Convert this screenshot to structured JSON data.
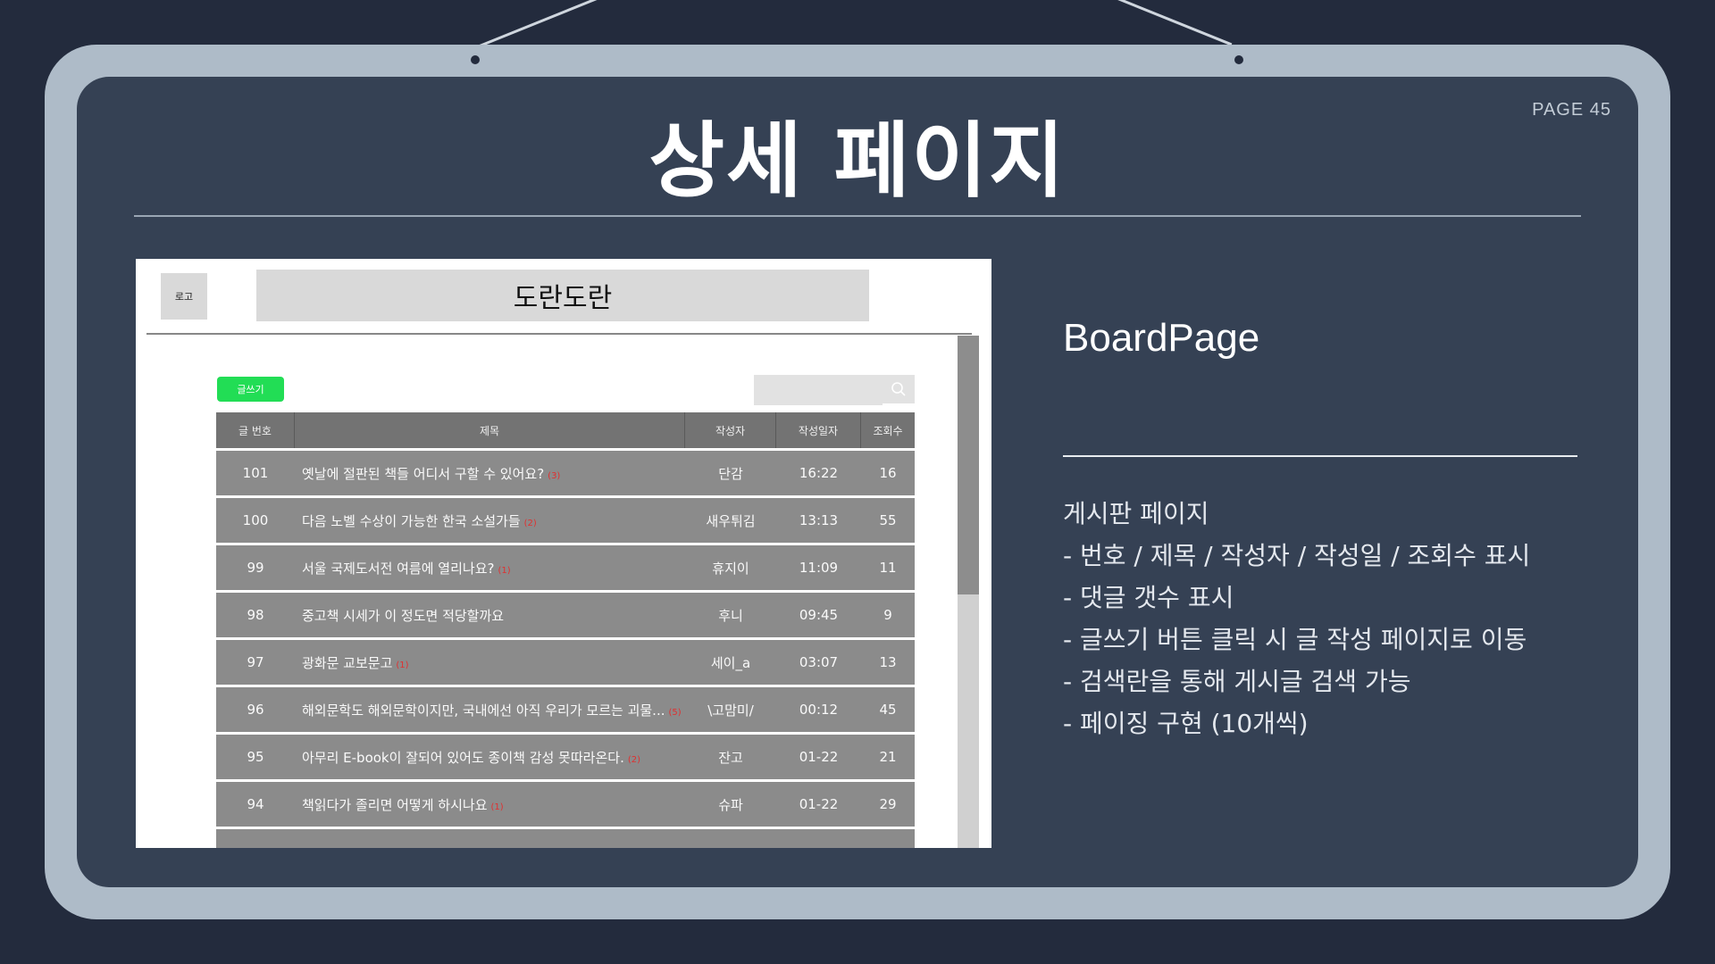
{
  "slide": {
    "page_label": "PAGE 45",
    "title": "상세 페이지",
    "subtitle": "BoardPage",
    "description": [
      "게시판 페이지",
      "- 번호 / 제목 / 작성자 / 작성일 / 조회수 표시",
      "- 댓글 갯수 표시",
      "- 글쓰기 버튼 클릭 시 글 작성 페이지로 이동",
      "- 검색란을 통해 게시글 검색 가능",
      "- 페이징 구현 (10개씩)"
    ]
  },
  "mock": {
    "logo_label": "로고",
    "site_title": "도란도란",
    "write_button": "글쓰기",
    "search": {
      "placeholder": "",
      "icon": "search-icon"
    },
    "columns": [
      "글 번호",
      "제목",
      "작성자",
      "작성일자",
      "조회수"
    ],
    "rows": [
      {
        "no": "101",
        "title": "옛날에 절판된 책들 어디서 구할 수 있어요?",
        "comments": "(3)",
        "author": "단감",
        "date": "16:22",
        "views": "16"
      },
      {
        "no": "100",
        "title": "다음 노벨 수상이 가능한 한국 소설가들",
        "comments": "(2)",
        "author": "새우튀김",
        "date": "13:13",
        "views": "55"
      },
      {
        "no": "99",
        "title": "서울 국제도서전 여름에 열리나요?",
        "comments": "(1)",
        "author": "휴지이",
        "date": "11:09",
        "views": "11"
      },
      {
        "no": "98",
        "title": "중고책 시세가 이 정도면 적당할까요",
        "comments": "",
        "author": "후니",
        "date": "09:45",
        "views": "9"
      },
      {
        "no": "97",
        "title": "광화문 교보문고",
        "comments": "(1)",
        "author": "세이_a",
        "date": "03:07",
        "views": "13"
      },
      {
        "no": "96",
        "title": "해외문학도 해외문학이지만, 국내에선 아직 우리가 모르는 괴물...",
        "comments": "(5)",
        "author": "\\고맘미/",
        "date": "00:12",
        "views": "45"
      },
      {
        "no": "95",
        "title": "아무리 E-book이 잘되어 있어도 종이책 감성 못따라온다.",
        "comments": "(2)",
        "author": "잔고",
        "date": "01-22",
        "views": "21"
      },
      {
        "no": "94",
        "title": "책읽다가 졸리면 어떻게 하시나요",
        "comments": "(1)",
        "author": "슈파",
        "date": "01-22",
        "views": "29"
      }
    ]
  }
}
